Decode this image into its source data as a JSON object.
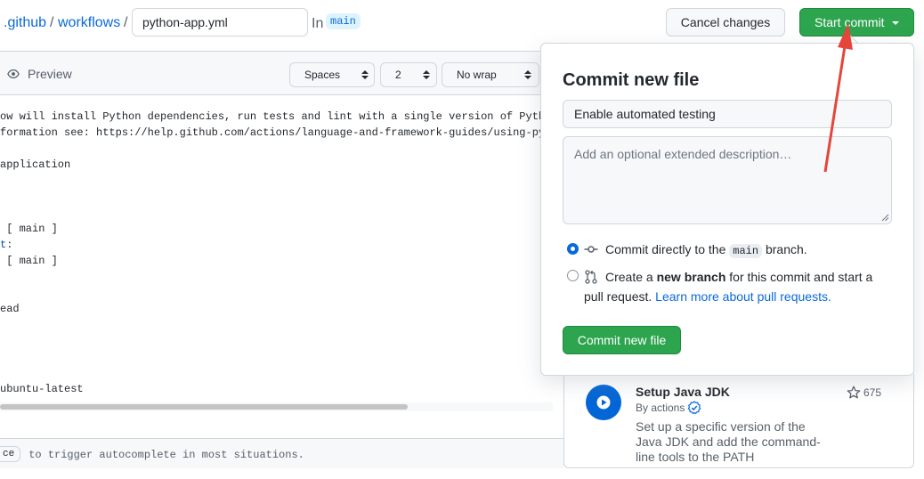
{
  "breadcrumb": {
    "dir1": ".github",
    "sep1": "/",
    "dir2": "workflows",
    "sep2": "/"
  },
  "file": {
    "name_value": "python-app.yml",
    "in_label": "In",
    "branch": "main"
  },
  "header_actions": {
    "cancel_label": "Cancel changes",
    "start_commit_label": "Start commit"
  },
  "editor": {
    "preview_label": "Preview",
    "indent_mode": "Spaces",
    "indent_size": "2",
    "wrap_mode": "No wrap",
    "lines": [
      {
        "text": "ow will install Python dependencies, run tests and lint with a single version of Pyth",
        "row": 0
      },
      {
        "text": "formation see: https://help.github.com/actions/language-and-framework-guides/using-py",
        "row": 1
      },
      {
        "text": "application",
        "row": 3
      },
      {
        "text": " [ main ]",
        "row": 7
      },
      {
        "text": "t",
        "suffix": ":",
        "row": 8
      },
      {
        "text": " [ main ]",
        "row": 9
      },
      {
        "text": "ead",
        "row": 12
      },
      {
        "text": "ubuntu-latest",
        "row": 17
      }
    ],
    "footer_key": "ce",
    "footer_text": " to trigger autocomplete in most situations."
  },
  "commit_dialog": {
    "title": "Commit new file",
    "summary_value": "Enable automated testing",
    "description_placeholder": "Add an optional extended description…",
    "option_direct_prefix": "Commit directly to the ",
    "option_direct_branch": "main",
    "option_direct_suffix": " branch.",
    "option_branch_prefix": "Create a ",
    "option_branch_bold": "new branch",
    "option_branch_suffix": " for this commit and start a",
    "option_branch_line2": "pull request. ",
    "option_branch_link": "Learn more about pull requests.",
    "selected_option": "direct",
    "commit_button_label": "Commit new file"
  },
  "marketplace": {
    "action_title": "Setup Java JDK",
    "action_by": "By actions",
    "action_description": "Set up a specific version of the Java JDK and add the command-line tools to the PATH",
    "stars": "675"
  },
  "colors": {
    "primary_green": "#2da44e",
    "link_blue": "#0969da",
    "annotation_red": "#e5453a",
    "action_logo_blue": "#0366d6"
  },
  "icons": [
    "eye-icon",
    "chevron-down-icon",
    "select-arrows-icon",
    "commit-icon",
    "git-pull-request-icon",
    "verified-icon",
    "star-icon",
    "play-icon",
    "resize-grip-icon"
  ]
}
